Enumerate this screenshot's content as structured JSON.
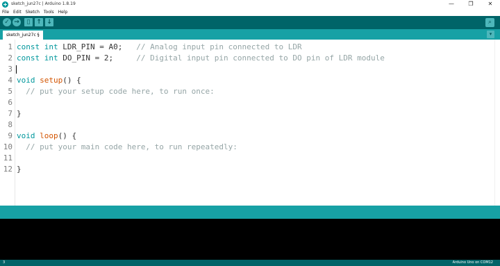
{
  "window": {
    "title": "sketch_jun27c | Arduino 1.8.19",
    "minimize": "—",
    "maximize": "❐",
    "close": "✕"
  },
  "menu": [
    "File",
    "Edit",
    "Sketch",
    "Tools",
    "Help"
  ],
  "toolbar": {
    "verify_icon": "✓",
    "upload_icon": "→",
    "new_icon": "▯",
    "open_icon": "↑",
    "save_icon": "↓",
    "serial_icon": "⌕"
  },
  "tab": {
    "label": "sketch_jun27c §",
    "menu_icon": "▾"
  },
  "editor": {
    "line_numbers": [
      "1",
      "2",
      "3",
      "4",
      "5",
      "6",
      "7",
      "8",
      "9",
      "10",
      "11",
      "12"
    ],
    "lines": {
      "l1": {
        "kw": "const int",
        "code": " LDR_PIN = A0;   ",
        "comment": "// Analog input pin connected to LDR"
      },
      "l2": {
        "kw": "const int",
        "code": " DO_PIN = 2;     ",
        "comment": "// Digital input pin connected to DO pin of LDR module"
      },
      "l4": {
        "kw": "void",
        "fn": "setup",
        "rest": "() {"
      },
      "l5": {
        "comment": "// put your setup code here, to run once:"
      },
      "l7": {
        "text": "}"
      },
      "l9": {
        "kw": "void",
        "fn": "loop",
        "rest": "() {"
      },
      "l10": {
        "comment": "// put your main code here, to run repeatedly:"
      },
      "l12": {
        "text": "}"
      }
    }
  },
  "status": {
    "line": "3",
    "board": "Arduino Uno on COM12"
  },
  "colors": {
    "toolbar_dark": "#006468",
    "tab_teal": "#17a1a5",
    "keyword": "#00979c",
    "function": "#d35400",
    "comment": "#95a5a6"
  }
}
